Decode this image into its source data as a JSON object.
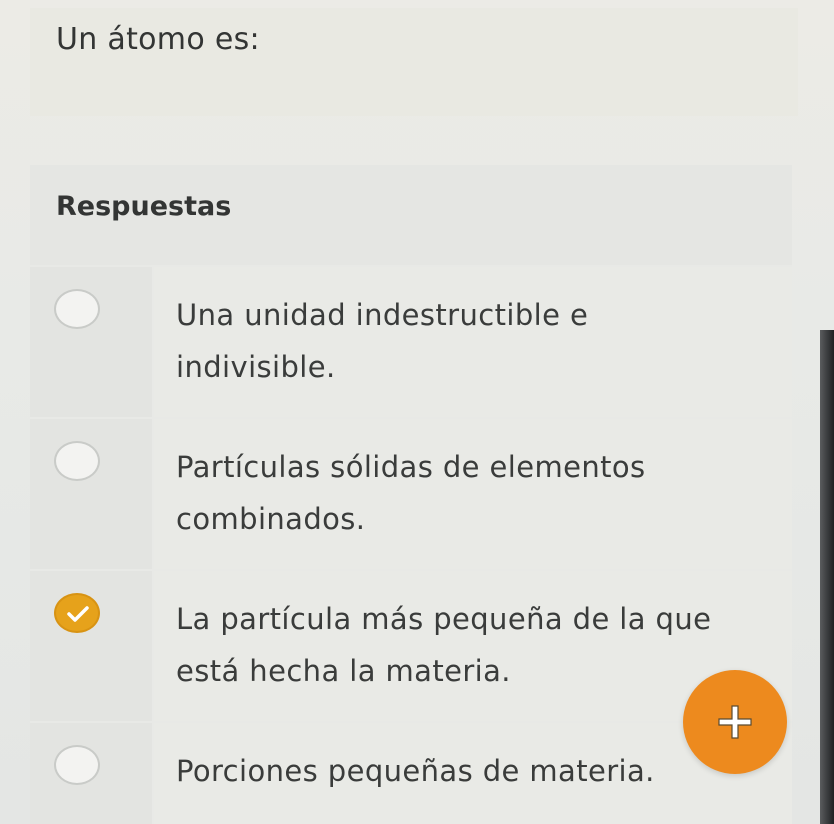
{
  "question": {
    "text": "Un átomo es:"
  },
  "answers": {
    "title": "Respuestas",
    "options": [
      {
        "text": "Una unidad indestructible e indivisible.",
        "selected": false
      },
      {
        "text": "Partículas sólidas de elementos combinados.",
        "selected": false
      },
      {
        "text": "La partícula más pequeña de la que está hecha la materia.",
        "selected": true
      },
      {
        "text": "Porciones pequeñas de materia.",
        "selected": false
      }
    ]
  },
  "fab": {
    "icon": "plus-icon"
  },
  "colors": {
    "accent_selected": "#e6a21b",
    "fab": "#ed8a1e",
    "text": "#3a3c3b",
    "background": "#e9eae6"
  }
}
